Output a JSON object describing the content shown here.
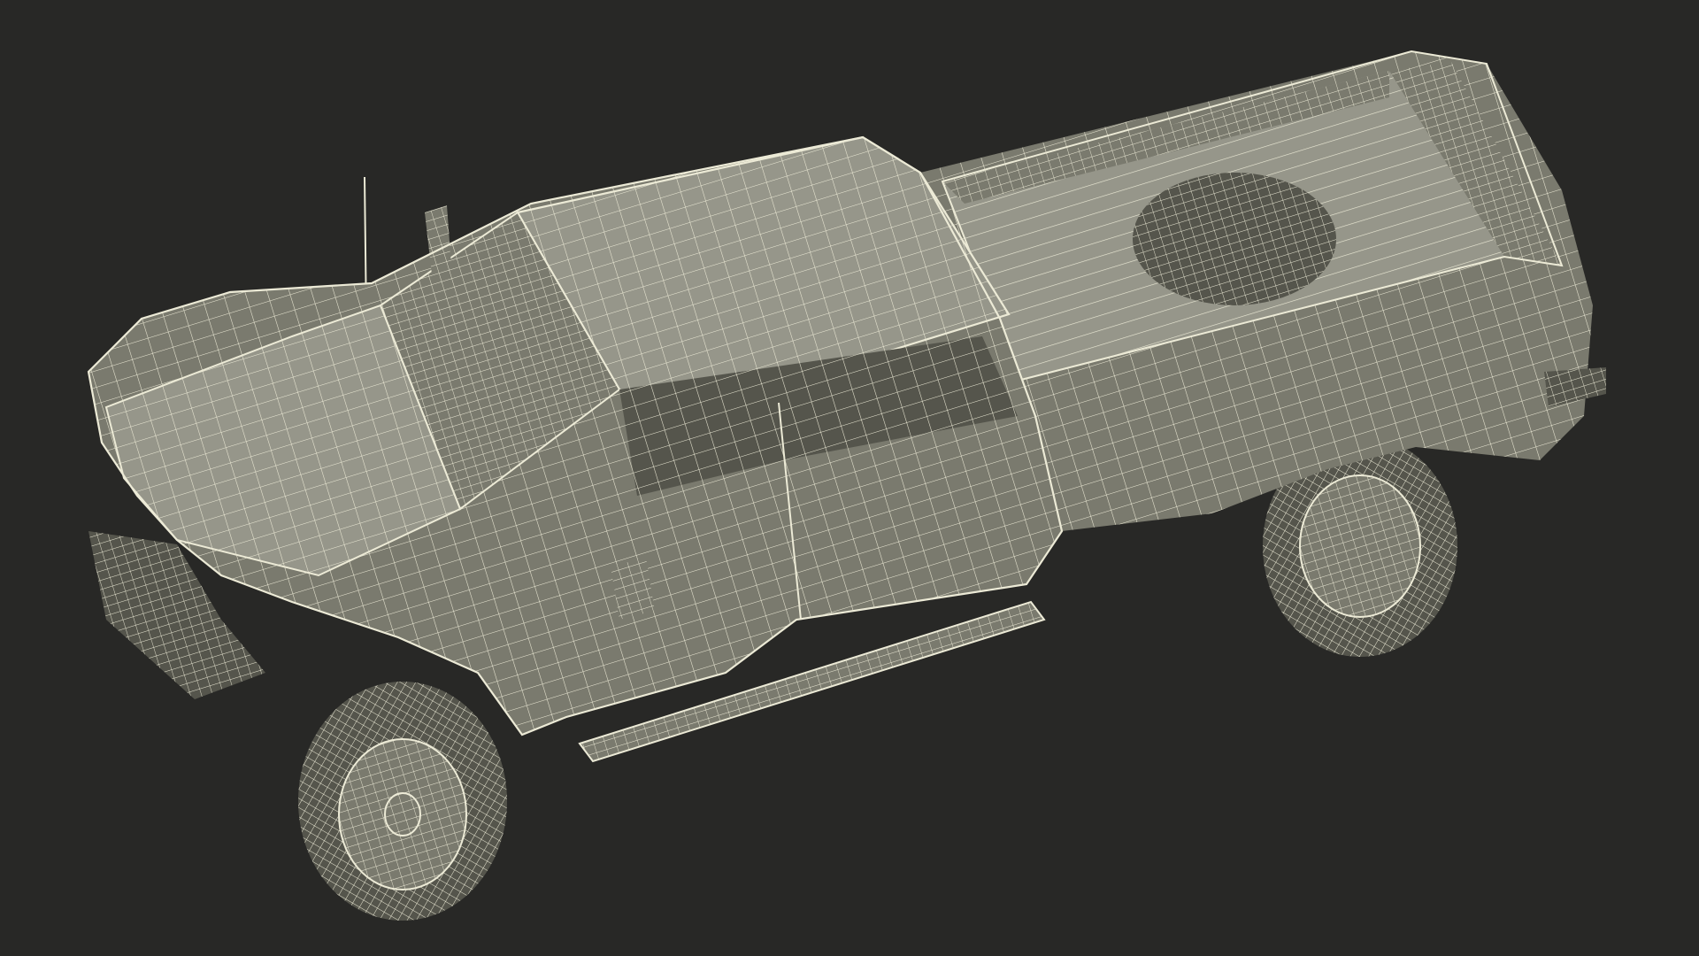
{
  "scene": {
    "background": "#282826",
    "wire_color": "#ecead6",
    "body_fill": "#7a7a6e",
    "body_fill_dark": "#55554c",
    "body_fill_light": "#96968a",
    "object_icon": "pickup-truck-icon",
    "render_style": "wireframe-over-clay"
  }
}
